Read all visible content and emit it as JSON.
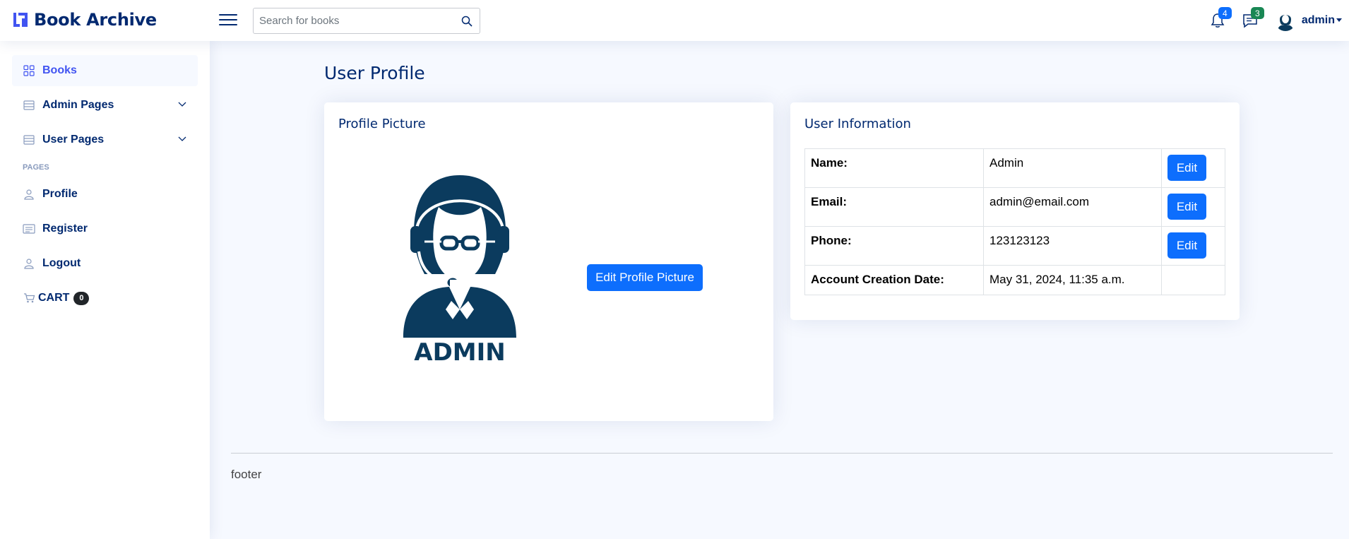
{
  "app": {
    "title": "Book Archive"
  },
  "header": {
    "search_placeholder": "Search for books",
    "notifications_count": "4",
    "messages_count": "3",
    "user_name": "admin"
  },
  "sidebar": {
    "items": [
      {
        "label": "Books",
        "icon": "grid-icon",
        "active": true
      },
      {
        "label": "Admin Pages",
        "icon": "menu-icon",
        "expandable": true
      },
      {
        "label": "User Pages",
        "icon": "menu-icon",
        "expandable": true
      }
    ],
    "heading": "PAGES",
    "pages": [
      {
        "label": "Profile",
        "icon": "person-icon"
      },
      {
        "label": "Register",
        "icon": "card-list-icon"
      },
      {
        "label": "Logout",
        "icon": "person-icon"
      }
    ],
    "cart": {
      "label": "CART",
      "count": "0",
      "icon": "cart-icon"
    }
  },
  "main": {
    "page_title": "User Profile",
    "profile_card": {
      "title": "Profile Picture",
      "image_caption": "ADMIN",
      "edit_button": "Edit Profile Picture"
    },
    "info_card": {
      "title": "User Information",
      "rows": [
        {
          "label": "Name:",
          "value": "Admin",
          "action": "Edit"
        },
        {
          "label": "Email:",
          "value": "admin@email.com",
          "action": "Edit"
        },
        {
          "label": "Phone:",
          "value": "123123123",
          "action": "Edit"
        },
        {
          "label": "Account Creation Date:",
          "value": "May 31, 2024, 11:35 a.m.",
          "action": ""
        }
      ]
    }
  },
  "footer": {
    "text": "footer"
  },
  "colors": {
    "primary_text": "#012970",
    "accent": "#4154f1",
    "button": "#0d6efd",
    "badge_green": "#198754",
    "background": "#f6f9ff"
  }
}
